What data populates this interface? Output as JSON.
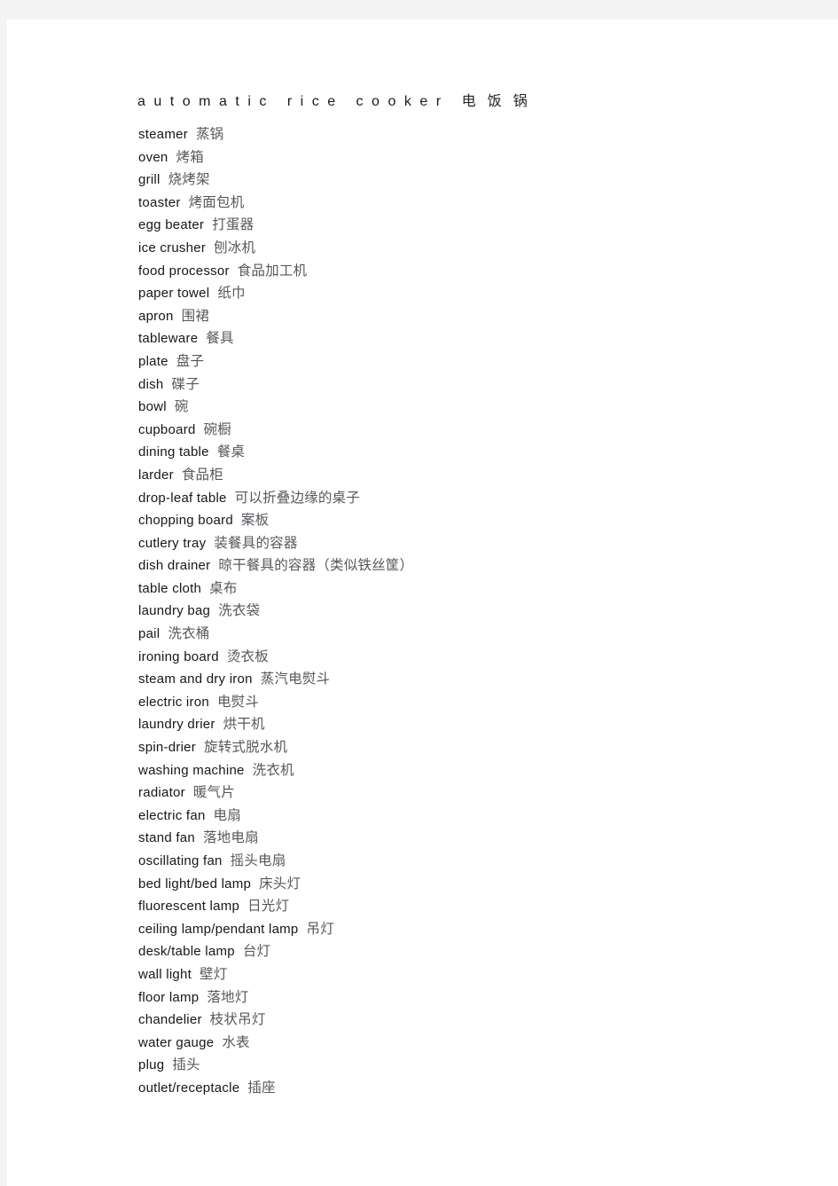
{
  "document": {
    "heading": {
      "english": "automatic rice cooker",
      "chinese": "电饭锅"
    },
    "colors": {
      "page_background": "#ffffff",
      "outer_background": "#f4f4f5",
      "english_text": "#15171a",
      "chinese_text": "#55595d"
    },
    "entries": [
      {
        "english": "steamer",
        "chinese": "蒸锅"
      },
      {
        "english": "oven",
        "chinese": "烤箱"
      },
      {
        "english": "grill",
        "chinese": "烧烤架"
      },
      {
        "english": "toaster",
        "chinese": "烤面包机"
      },
      {
        "english": "egg beater",
        "chinese": "打蛋器"
      },
      {
        "english": "ice crusher",
        "chinese": "刨冰机"
      },
      {
        "english": "food processor",
        "chinese": "食品加工机"
      },
      {
        "english": "paper towel",
        "chinese": "纸巾"
      },
      {
        "english": "apron",
        "chinese": "围裙"
      },
      {
        "english": "tableware",
        "chinese": "餐具"
      },
      {
        "english": "plate",
        "chinese": "盘子"
      },
      {
        "english": "dish",
        "chinese": "碟子"
      },
      {
        "english": "bowl",
        "chinese": "碗"
      },
      {
        "english": "cupboard",
        "chinese": "碗橱"
      },
      {
        "english": "dining table",
        "chinese": "餐桌"
      },
      {
        "english": "larder",
        "chinese": "食品柜"
      },
      {
        "english": "drop-leaf table",
        "chinese": "可以折叠边缘的桌子"
      },
      {
        "english": "chopping board",
        "chinese": "案板"
      },
      {
        "english": "cutlery tray",
        "chinese": "装餐具的容器"
      },
      {
        "english": "dish drainer",
        "chinese": "晾干餐具的容器（类似铁丝筐）"
      },
      {
        "english": "table cloth",
        "chinese": "桌布"
      },
      {
        "english": "laundry bag",
        "chinese": "洗衣袋"
      },
      {
        "english": "pail",
        "chinese": "洗衣桶"
      },
      {
        "english": "ironing board",
        "chinese": "烫衣板"
      },
      {
        "english": "steam and dry iron",
        "chinese": "蒸汽电熨斗"
      },
      {
        "english": "electric iron",
        "chinese": "电熨斗"
      },
      {
        "english": "laundry drier",
        "chinese": "烘干机"
      },
      {
        "english": "spin-drier",
        "chinese": "旋转式脱水机"
      },
      {
        "english": "washing machine",
        "chinese": "洗衣机"
      },
      {
        "english": "radiator",
        "chinese": "暖气片"
      },
      {
        "english": "electric fan",
        "chinese": "电扇"
      },
      {
        "english": "stand fan",
        "chinese": "落地电扇"
      },
      {
        "english": "oscillating fan",
        "chinese": "摇头电扇"
      },
      {
        "english": "bed light/bed lamp",
        "chinese": "床头灯"
      },
      {
        "english": "fluorescent lamp",
        "chinese": "日光灯"
      },
      {
        "english": "ceiling lamp/pendant lamp",
        "chinese": "吊灯"
      },
      {
        "english": "desk/table lamp",
        "chinese": "台灯"
      },
      {
        "english": "wall light",
        "chinese": "壁灯"
      },
      {
        "english": "floor lamp",
        "chinese": "落地灯"
      },
      {
        "english": "chandelier",
        "chinese": "枝状吊灯"
      },
      {
        "english": "water gauge",
        "chinese": "水表"
      },
      {
        "english": "plug",
        "chinese": "插头"
      },
      {
        "english": "outlet/receptacle",
        "chinese": "插座"
      }
    ]
  }
}
